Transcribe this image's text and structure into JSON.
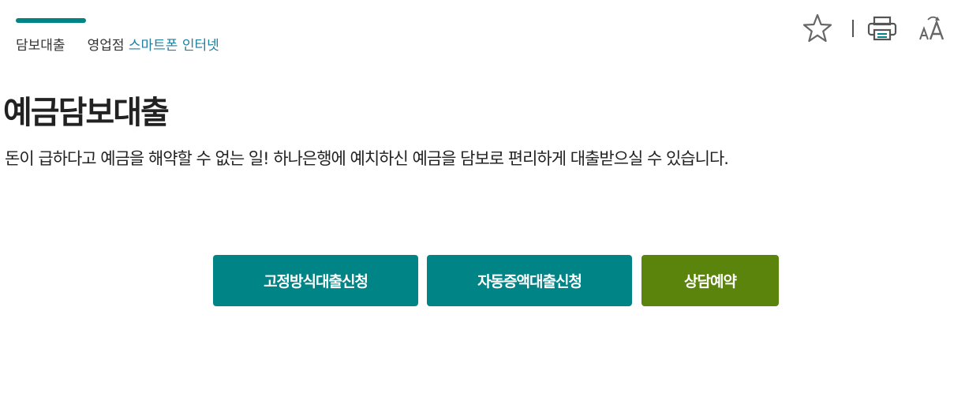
{
  "breadcrumb": {
    "category": "담보대출",
    "channel_prefix": "영업점 ",
    "channel_highlight": "스마트폰 인터넷"
  },
  "toolbar": {
    "favorite_icon": "star-outline-icon",
    "print_icon": "printer-icon",
    "font_size_icon": "font-size-icon"
  },
  "product": {
    "title": "예금담보대출",
    "description": "돈이 급하다고 예금을 해약할 수 없는 일! 하나은행에 예치하신 예금을 담보로 편리하게 대출받으실 수 있습니다."
  },
  "actions": {
    "fixed_rate_label": "고정방식대출신청",
    "auto_increase_label": "자동증액대출신청",
    "consult_label": "상담예약"
  },
  "colors": {
    "accent": "#008485",
    "consult": "#5a840c",
    "highlight_text": "#1f7fa0"
  }
}
